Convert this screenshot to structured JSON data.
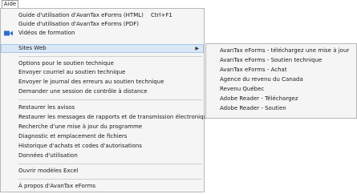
{
  "menubar": {
    "title": "Aide"
  },
  "menu": {
    "items": [
      {
        "label": "Guide d'utilisation d'AvanTax eForms (HTML)",
        "shortcut": "Ctrl+F1"
      },
      {
        "label": "Guide d'utilisation d'AvanTax eForms (PDF)"
      },
      {
        "label": "Vidéos de formation",
        "icon": "video-icon"
      },
      {
        "label": "Sites Web",
        "submenu_arrow": "▶"
      },
      {
        "label": "Options pour le soutien technique"
      },
      {
        "label": "Envoyer courriel au soutien technique"
      },
      {
        "label": "Envoyer le journal des erreurs au soutien technique"
      },
      {
        "label": "Demander une session de contrôle à distance"
      },
      {
        "label": "Restaurer les avisos"
      },
      {
        "label": "Restaurer les messages de rapports et de transmission électronique"
      },
      {
        "label": "Recherche d'une mise à jour du programme"
      },
      {
        "label": "Diagnostic et emplacement de fichiers"
      },
      {
        "label": "Historique d'achats et codes d'autorisations"
      },
      {
        "label": "Données d'utilisation"
      },
      {
        "label": "Ouvrir modèles Excel"
      },
      {
        "label": "À propos d'AvanTax eForms"
      }
    ]
  },
  "submenu": {
    "items": [
      {
        "label": "AvanTax eForms - téléchargez une mise à jour"
      },
      {
        "label": "AvanTax eForms - Soutien technique"
      },
      {
        "label": "AvanTax eForms - Achat"
      },
      {
        "label": "Agence du revenu du Canada"
      },
      {
        "label": "Revenu Québec"
      },
      {
        "label": "Adobe Reader - Téléchargez"
      },
      {
        "label": "Adobe Reader - Soutien"
      }
    ]
  },
  "colors": {
    "menu_background": "#f5f5f5",
    "highlight": "#d9e7f7",
    "highlight_border": "#a9c7ea",
    "video_icon": "#2f6fc9"
  }
}
